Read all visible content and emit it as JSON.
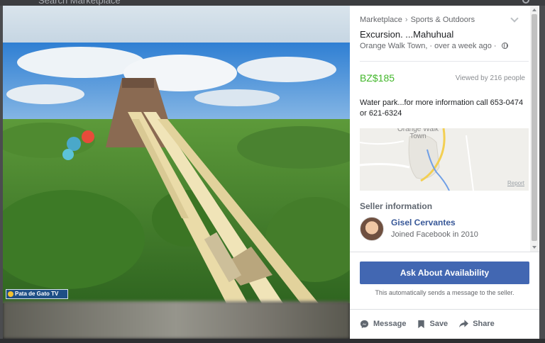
{
  "background": {
    "search_placeholder": "Search Marketplace"
  },
  "photo": {
    "watermark": "Pata de Gato TV",
    "sky_color": "#3a86d6",
    "vegetation_color": "#4c8b2f",
    "slide_color": "#e7d6a3"
  },
  "listing": {
    "breadcrumb": [
      "Marketplace",
      "Sports & Outdoors"
    ],
    "breadcrumb_separator": "›",
    "title": "Excursion. ...Mahuhual",
    "location": "Orange Walk Town, ·",
    "posted": "over a week ago ·",
    "price": "BZ$185",
    "price_color": "#42b72a",
    "views": "Viewed by 216 people",
    "description": "Water park...for more information call 653-0474 or 621-6324"
  },
  "map": {
    "place_label": "Orange Walk Town",
    "report_link": "Report"
  },
  "seller": {
    "heading": "Seller information",
    "name": "Gisel Cervantes",
    "joined": "Joined Facebook in 2010"
  },
  "footer": {
    "ask_button": "Ask About Availability",
    "ask_button_color": "#4267b2",
    "note": "This automatically sends a message to the seller.",
    "actions": [
      {
        "label": "Message",
        "icon": "messenger-icon"
      },
      {
        "label": "Save",
        "icon": "bookmark-icon"
      },
      {
        "label": "Share",
        "icon": "share-arrow-icon"
      }
    ]
  }
}
